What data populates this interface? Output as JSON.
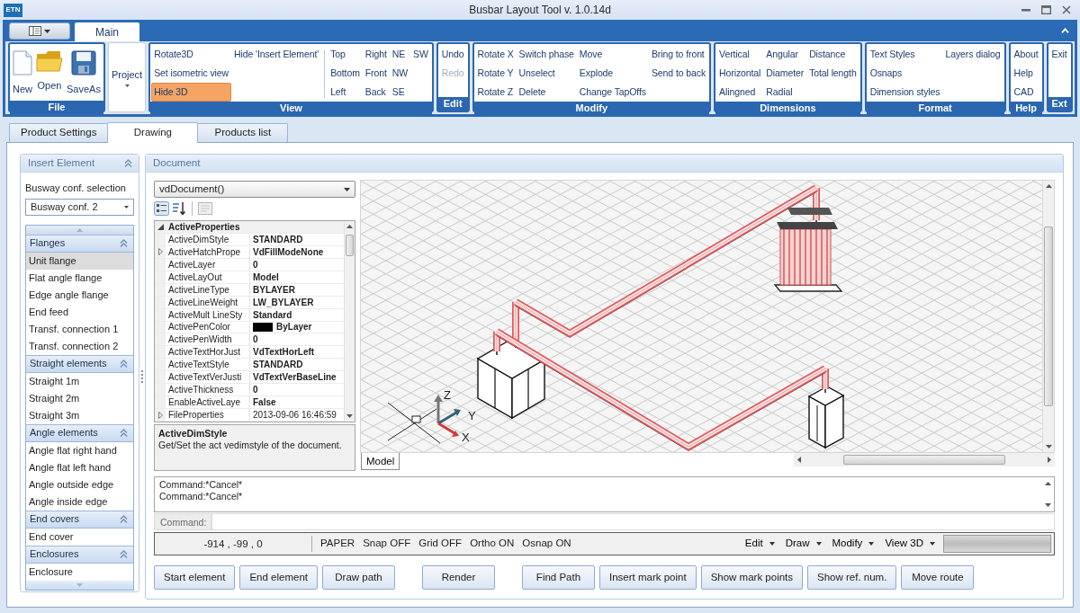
{
  "window": {
    "logo": "ETN",
    "title": "Busbar Layout Tool v. 1.0.14d"
  },
  "ribbon": {
    "tabs": [
      {
        "label": "Main",
        "selected": true
      }
    ],
    "groups": [
      {
        "label": "File",
        "kind": "large",
        "sections": [
          [
            [
              {
                "label": "New",
                "on": false,
                "disabled": false
              }
            ],
            [
              {
                "label": "Open",
                "on": false,
                "disabled": false
              }
            ],
            [
              {
                "label": "SaveAs",
                "on": false,
                "disabled": false
              }
            ]
          ]
        ]
      },
      {
        "kind": "dropdown",
        "sections": [
          [
            [
              {
                "label": "Project",
                "on": false,
                "disabled": false
              }
            ]
          ]
        ]
      },
      {
        "label": "View",
        "kind": "small",
        "sections": [
          [
            [
              {
                "label": "Rotate3D",
                "on": false,
                "disabled": false
              },
              {
                "label": "Set isometric view",
                "on": false,
                "disabled": false
              },
              {
                "label": "Hide 3D",
                "on": true,
                "disabled": false
              }
            ],
            [
              {
                "label": "Hide 'Insert Element'",
                "on": false,
                "disabled": false
              }
            ]
          ],
          [
            [
              {
                "label": "Top",
                "on": false,
                "disabled": false
              },
              {
                "label": "Bottom",
                "on": false,
                "disabled": false
              },
              {
                "label": "Left",
                "on": false,
                "disabled": false
              }
            ],
            [
              {
                "label": "Right",
                "on": false,
                "disabled": false
              },
              {
                "label": "Front",
                "on": false,
                "disabled": false
              },
              {
                "label": "Back",
                "on": false,
                "disabled": false
              }
            ],
            [
              {
                "label": "NE",
                "on": false,
                "disabled": false
              },
              {
                "label": "NW",
                "on": false,
                "disabled": false
              },
              {
                "label": "SE",
                "on": false,
                "disabled": false
              }
            ],
            [
              {
                "label": "SW",
                "on": false,
                "disabled": false
              }
            ]
          ]
        ]
      },
      {
        "label": "Edit",
        "kind": "small",
        "sections": [
          [
            [
              {
                "label": "Undo",
                "on": false,
                "disabled": false
              },
              {
                "label": "Redo",
                "on": false,
                "disabled": true
              }
            ]
          ]
        ]
      },
      {
        "label": "Modify",
        "kind": "small",
        "sections": [
          [
            [
              {
                "label": "Rotate X",
                "on": false,
                "disabled": false
              },
              {
                "label": "Rotate Y",
                "on": false,
                "disabled": false
              },
              {
                "label": "Rotate Z",
                "on": false,
                "disabled": false
              }
            ],
            [
              {
                "label": "Switch phase",
                "on": false,
                "disabled": false
              },
              {
                "label": "Unselect",
                "on": false,
                "disabled": false
              },
              {
                "label": "Delete",
                "on": false,
                "disabled": false
              }
            ],
            [
              {
                "label": "Move",
                "on": false,
                "disabled": false
              },
              {
                "label": "Explode",
                "on": false,
                "disabled": false
              },
              {
                "label": "Change TapOffs",
                "on": false,
                "disabled": false
              }
            ],
            [
              {
                "label": "Bring to front",
                "on": false,
                "disabled": false
              },
              {
                "label": "Send to back",
                "on": false,
                "disabled": false
              }
            ]
          ]
        ]
      },
      {
        "label": "Dimensions",
        "kind": "small",
        "sections": [
          [
            [
              {
                "label": "Vertical",
                "on": false,
                "disabled": false
              },
              {
                "label": "Horizontal",
                "on": false,
                "disabled": false
              },
              {
                "label": "Alingned",
                "on": false,
                "disabled": false
              }
            ],
            [
              {
                "label": "Angular",
                "on": false,
                "disabled": false
              },
              {
                "label": "Diameter",
                "on": false,
                "disabled": false
              },
              {
                "label": "Radial",
                "on": false,
                "disabled": false
              }
            ],
            [
              {
                "label": "Distance",
                "on": false,
                "disabled": false
              },
              {
                "label": "Total length",
                "on": false,
                "disabled": false
              }
            ]
          ]
        ]
      },
      {
        "label": "Format",
        "kind": "small",
        "sections": [
          [
            [
              {
                "label": "Text Styles",
                "on": false,
                "disabled": false
              },
              {
                "label": "Osnaps",
                "on": false,
                "disabled": false
              },
              {
                "label": "Dimension styles",
                "on": false,
                "disabled": false
              }
            ],
            [
              {
                "label": "Layers dialog",
                "on": false,
                "disabled": false
              }
            ]
          ]
        ]
      },
      {
        "label": "Help",
        "kind": "small",
        "sections": [
          [
            [
              {
                "label": "About",
                "on": false,
                "disabled": false
              },
              {
                "label": "Help",
                "on": false,
                "disabled": false
              },
              {
                "label": "CAD",
                "on": false,
                "disabled": false
              }
            ]
          ]
        ]
      },
      {
        "label": "Ext",
        "kind": "small",
        "sections": [
          [
            [
              {
                "label": "Exit",
                "on": false,
                "disabled": false
              }
            ]
          ]
        ]
      }
    ]
  },
  "tabs": [
    {
      "label": "Product Settings",
      "selected": false
    },
    {
      "label": "Drawing",
      "selected": true
    },
    {
      "label": "Products list",
      "selected": false
    }
  ],
  "insert_panel": {
    "title": "Insert Element",
    "conf_label": "Busway conf. selection",
    "conf_value": "Busway conf. 2",
    "sections": [
      {
        "title": "Flanges",
        "expanded": true,
        "items": [
          {
            "label": "Unit flange",
            "selected": true
          },
          {
            "label": "Flat angle flange",
            "selected": false
          },
          {
            "label": "Edge angle flange",
            "selected": false
          },
          {
            "label": "End feed",
            "selected": false
          },
          {
            "label": "Transf. connection 1",
            "selected": false
          },
          {
            "label": "Transf. connection 2",
            "selected": false
          }
        ]
      },
      {
        "title": "Straight elements",
        "expanded": true,
        "items": [
          {
            "label": "Straight 1m",
            "selected": false
          },
          {
            "label": "Straight 2m",
            "selected": false
          },
          {
            "label": "Straight 3m",
            "selected": false
          }
        ]
      },
      {
        "title": "Angle elements",
        "expanded": true,
        "items": [
          {
            "label": "Angle flat right hand",
            "selected": false
          },
          {
            "label": "Angle flat left hand",
            "selected": false
          },
          {
            "label": "Angle outside edge",
            "selected": false
          },
          {
            "label": "Angle inside edge",
            "selected": false
          }
        ]
      },
      {
        "title": "End covers",
        "expanded": true,
        "items": [
          {
            "label": "End cover",
            "selected": false
          }
        ]
      },
      {
        "title": "Enclosures",
        "expanded": true,
        "items": [
          {
            "label": "Enclosure",
            "selected": false
          }
        ]
      }
    ]
  },
  "document": {
    "title": "Document",
    "object_select": "vdDocument()",
    "property_grid": {
      "categories": [
        {
          "label": "ActiveProperties",
          "expanded": true,
          "properties": [
            {
              "name": "ActiveDimStyle",
              "value": "STANDARD",
              "expandable": false,
              "modified": true
            },
            {
              "name": "ActiveHatchPrope",
              "value": "VdFillModeNone",
              "expandable": true,
              "modified": true
            },
            {
              "name": "ActiveLayer",
              "value": "0",
              "expandable": false,
              "modified": true
            },
            {
              "name": "ActiveLayOut",
              "value": "Model",
              "expandable": false,
              "modified": true
            },
            {
              "name": "ActiveLineType",
              "value": "BYLAYER",
              "expandable": false,
              "modified": true
            },
            {
              "name": "ActiveLineWeight",
              "value": "LW_BYLAYER",
              "expandable": false,
              "modified": true
            },
            {
              "name": "ActiveMult LineSty",
              "value": "Standard",
              "expandable": false,
              "modified": true
            },
            {
              "name": "ActivePenColor",
              "value": "ByLayer",
              "expandable": false,
              "modified": true,
              "color": "#000000"
            },
            {
              "name": "ActivePenWidth",
              "value": "0",
              "expandable": false,
              "modified": true
            },
            {
              "name": "ActiveTextHorJust",
              "value": "VdTextHorLeft",
              "expandable": false,
              "modified": true
            },
            {
              "name": "ActiveTextStyle",
              "value": "STANDARD",
              "expandable": false,
              "modified": true
            },
            {
              "name": "ActiveTextVerJusti",
              "value": "VdTextVerBaseLine",
              "expandable": false,
              "modified": true
            },
            {
              "name": "ActiveThickness",
              "value": "0",
              "expandable": false,
              "modified": true
            },
            {
              "name": "EnableActiveLaye",
              "value": "False",
              "expandable": false,
              "modified": true
            },
            {
              "name": "FileProperties",
              "value": "2013-09-06 16:46:59",
              "expandable": true,
              "modified": false
            }
          ]
        }
      ]
    },
    "description": {
      "title": "ActiveDimStyle",
      "text": "Get/Set the act vedimstyle of the document."
    },
    "canvas": {
      "axis_labels": [
        "Z",
        "Y",
        "X"
      ],
      "layout_tabs": [
        {
          "label": "Model",
          "selected": true
        }
      ]
    },
    "command_history": [
      "Command:*Cancel*",
      "Command:*Cancel*"
    ],
    "command_prompt": "Command:",
    "status_bar": {
      "coordinates": "-914 , -99 , 0",
      "modes": [
        "PAPER",
        "Snap OFF",
        "Grid OFF",
        "Ortho ON",
        "Osnap ON"
      ],
      "menus": [
        "Edit",
        "Draw",
        "Modify",
        "View 3D"
      ]
    }
  },
  "action_groups": [
    [
      "Start element",
      "End element",
      "Draw path"
    ],
    [
      "Render"
    ],
    [
      "Find Path",
      "Insert mark point",
      "Show mark points",
      "Show ref. num.",
      "Move route"
    ]
  ]
}
